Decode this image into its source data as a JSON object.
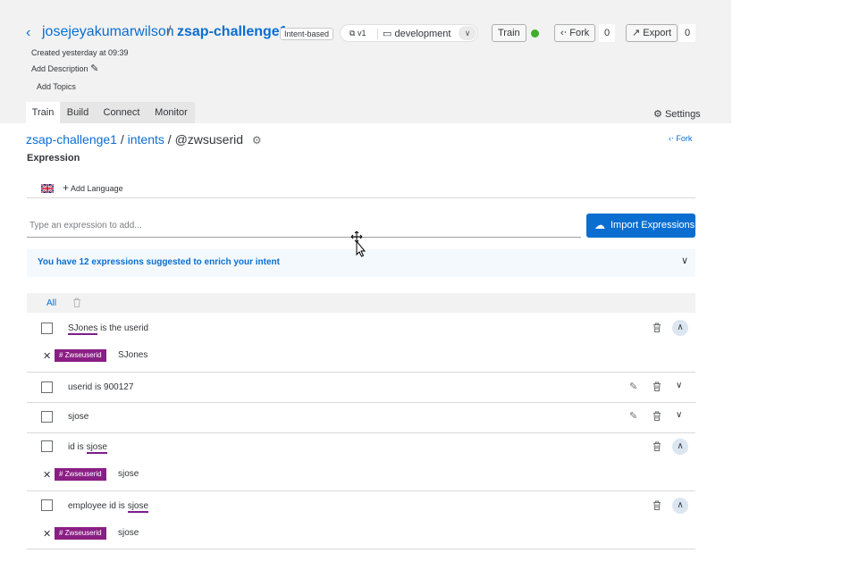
{
  "header": {
    "owner": "josejeyakumarwilson",
    "separator": "/",
    "bot_name": "zsap-challenge1",
    "bot_type": "Intent-based",
    "version": "v1",
    "environment": "development",
    "train_label": "Train",
    "train_status_color": "#3fae2a",
    "fork_label": "Fork",
    "fork_count": "0",
    "export_label": "Export",
    "export_count": "0",
    "created": "Created yesterday at 09:39",
    "add_description": "Add Description",
    "add_topics": "Add Topics"
  },
  "tabs": [
    {
      "label": "Train"
    },
    {
      "label": "Build"
    },
    {
      "label": "Connect"
    },
    {
      "label": "Monitor"
    }
  ],
  "settings_label": "Settings",
  "breadcrumb": {
    "bot": "zsap-challenge1",
    "sep": "/",
    "section": "intents",
    "intent": "@zwsuserid"
  },
  "fork_link": "Fork",
  "expression_heading": "Expression",
  "add_language": "Add Language",
  "expression_input": {
    "placeholder": "Type an expression to add..."
  },
  "import_label": "Import Expressions",
  "suggestion_text": "You have 12 expressions suggested to enrich your intent",
  "all_label": "All",
  "entity_tag": "Zwseuserid",
  "accent_color": "#0a6ed1",
  "entity_color": "#8b1e84",
  "expressions": [
    {
      "before": "",
      "entity": "SJones",
      "after": " is the userid",
      "tag_value": "SJones"
    },
    {
      "text": "userid is 900127"
    },
    {
      "text": "sjose"
    },
    {
      "before": "id is ",
      "entity": "sjose",
      "after": "",
      "tag_value": "sjose"
    },
    {
      "before": "employee id is ",
      "entity": "sjose",
      "after": "",
      "tag_value": "sjose"
    }
  ]
}
